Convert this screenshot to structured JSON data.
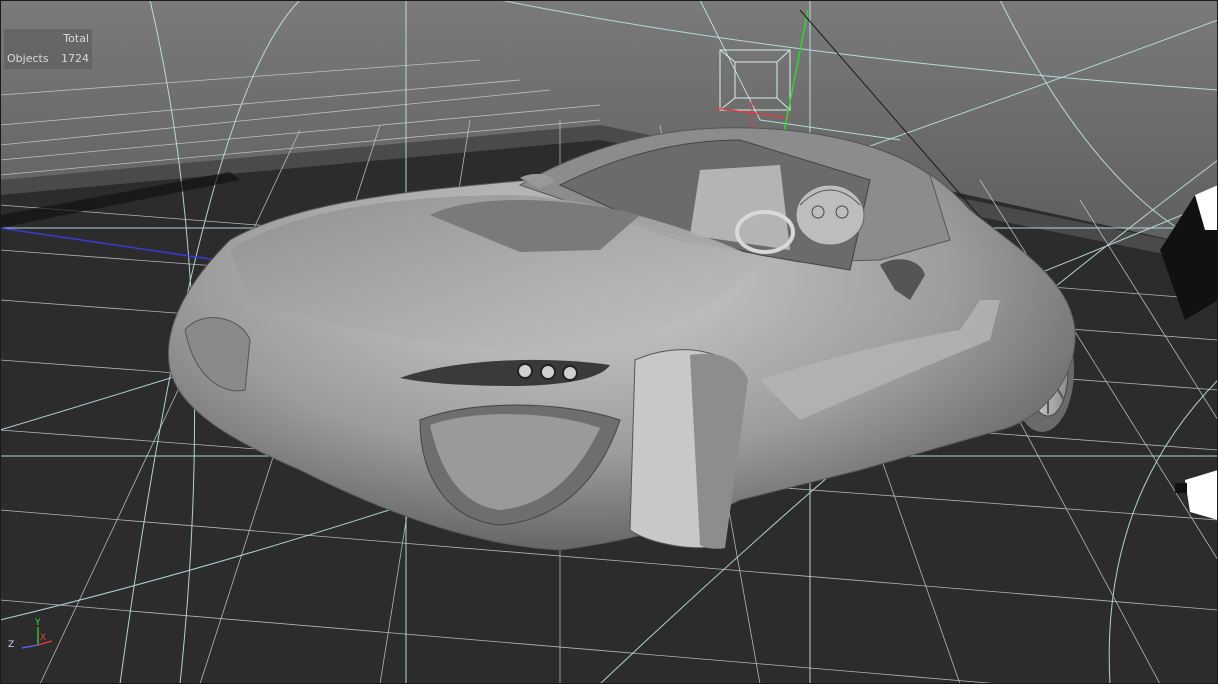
{
  "stats": {
    "header": "Total",
    "rows": [
      {
        "label": "Objects",
        "value": "1724"
      }
    ]
  },
  "axis_gizmo": {
    "y_label": "Y",
    "x_label": "X",
    "z_label": "Z",
    "y_color": "#3adf3a",
    "x_color": "#e04040",
    "z_color": "#5a6aff"
  },
  "colors": {
    "background_sky": "#6e6e6e",
    "background_floor": "#2b2b2b",
    "grid": "#cfd6d6",
    "guide": "#bfe6e0",
    "model": "#a8a8a8"
  }
}
